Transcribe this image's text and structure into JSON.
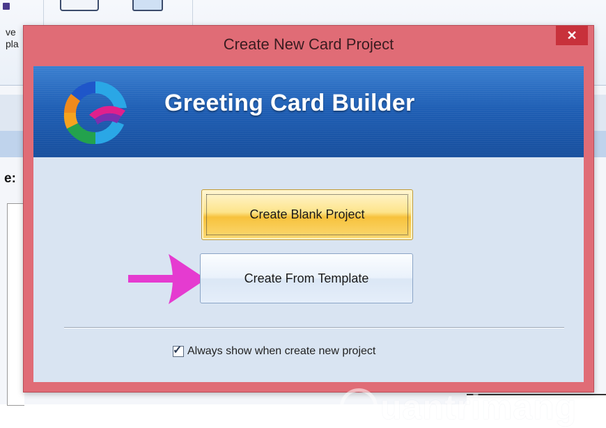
{
  "background_app": {
    "ribbon_text_line1": "ve",
    "ribbon_text_line2": "pla",
    "field_label": "e:"
  },
  "dialog": {
    "title": "Create New Card Project",
    "close_glyph": "✕",
    "banner_title": "Greeting Card Builder",
    "buttons": {
      "create_blank": "Create Blank Project",
      "create_from_template": "Create From Template"
    },
    "always_show": {
      "label": "Always show when create new project",
      "checked": true,
      "check_glyph": "✓"
    }
  },
  "watermark": {
    "text": "uantrimang"
  },
  "colors": {
    "dialog_frame": "#e06c76",
    "close_button": "#c8313b",
    "banner_blue": "#1f5fb5",
    "client_bg": "#d9e4f2",
    "arrow": "#e53bd0",
    "blank_button": "#f7c23c"
  },
  "icons": {
    "logo": "app-logo-icon",
    "arrow": "pointer-arrow-icon",
    "close": "close-icon"
  }
}
